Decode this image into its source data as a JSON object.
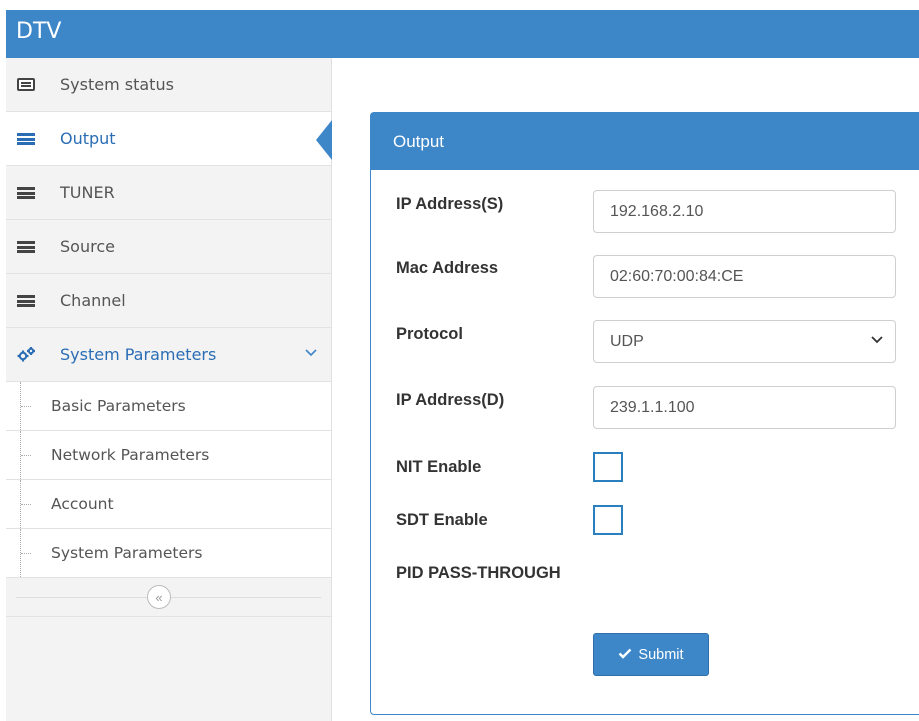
{
  "app": {
    "title": "DTV"
  },
  "sidebar": {
    "items": [
      {
        "label": "System status",
        "icon": "status-list-icon",
        "active": false
      },
      {
        "label": "Output",
        "icon": "menu-icon",
        "active": true
      },
      {
        "label": "TUNER",
        "icon": "menu-icon",
        "active": false
      },
      {
        "label": "Source",
        "icon": "menu-icon",
        "active": false
      },
      {
        "label": "Channel",
        "icon": "menu-icon",
        "active": false
      },
      {
        "label": "System Parameters",
        "icon": "gears-icon",
        "active": false,
        "expanded": true
      }
    ],
    "sub_items": [
      {
        "label": "Basic Parameters"
      },
      {
        "label": "Network Parameters"
      },
      {
        "label": "Account"
      },
      {
        "label": "System Parameters"
      }
    ],
    "collapse_glyph": "«"
  },
  "panel": {
    "title": "Output",
    "fields": {
      "ip_src": {
        "label": "IP Address(S)",
        "value": "192.168.2.10"
      },
      "mac": {
        "label": "Mac Address",
        "value": "02:60:70:00:84:CE"
      },
      "protocol": {
        "label": "Protocol",
        "value": "UDP"
      },
      "ip_dst": {
        "label": "IP Address(D)",
        "value": "239.1.1.100"
      },
      "nit": {
        "label": "NIT Enable",
        "checked": false
      },
      "sdt": {
        "label": "SDT Enable",
        "checked": false
      },
      "pid": {
        "label": "PID PASS-THROUGH"
      }
    },
    "submit_label": "Submit"
  },
  "colors": {
    "accent": "#3d87c9",
    "active_text": "#2a6db5"
  }
}
